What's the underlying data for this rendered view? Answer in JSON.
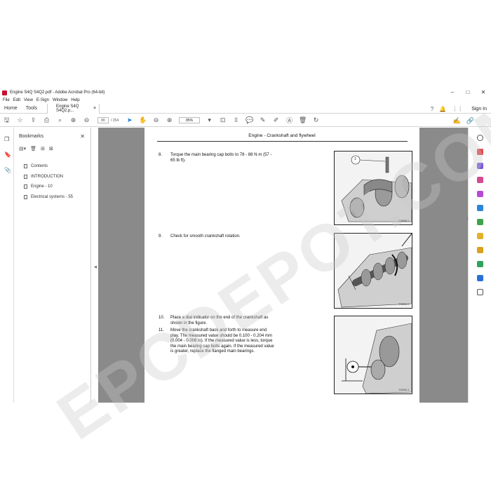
{
  "window": {
    "title": "Engine S4Q S4Q2.pdf - Adobe Acrobat Pro (64-bit)",
    "minimize": "–",
    "maximize": "□",
    "close": "✕"
  },
  "menu": [
    "File",
    "Edit",
    "View",
    "E-Sign",
    "Window",
    "Help"
  ],
  "tabs": {
    "home": "Home",
    "tools": "Tools",
    "document": "Engine S4Q S4Q2.p...",
    "document_close": "×",
    "signin": "Sign In"
  },
  "toolbar": {
    "page_current": "80",
    "page_total": "/ 254",
    "zoom": "85%"
  },
  "bookmarks": {
    "title": "Bookmarks",
    "close": "✕",
    "items": [
      "Contents",
      "INTRODUCTION",
      "Engine - 10",
      "Electrical systems - 55"
    ]
  },
  "document": {
    "header": "Engine - Crankshaft and flywheel",
    "steps": [
      {
        "num": "8.",
        "text": "Torque the main bearing cap bolts to 78 - 88 N·m (57 - 65 lb ft).",
        "figure_caption": "TNS06I  1"
      },
      {
        "num": "9.",
        "text": "Check for smooth crankshaft rotation.",
        "figure_caption": "TNS06I  2"
      },
      {
        "num": "10.",
        "text": "Place a dial indicator on the end of the crankshaft as shown in the figure."
      },
      {
        "num": "11.",
        "text": "Move the crankshaft back and forth to measure end play.  The measured value should be 0.100 - 0.204 mm (0.004 - 0.008 in).  If the measured value is less, torque the main bearing cap bolts again.  If the measured value is greater, replace the flanged main bearings.",
        "figure_caption": "TNS06I  3"
      }
    ],
    "callout": "1"
  },
  "watermark": "EPCDEPOT.COM",
  "colors": {
    "accent": "#1473e6",
    "acrobat_red": "#c8102e",
    "doc_background": "#8a8a8a"
  }
}
